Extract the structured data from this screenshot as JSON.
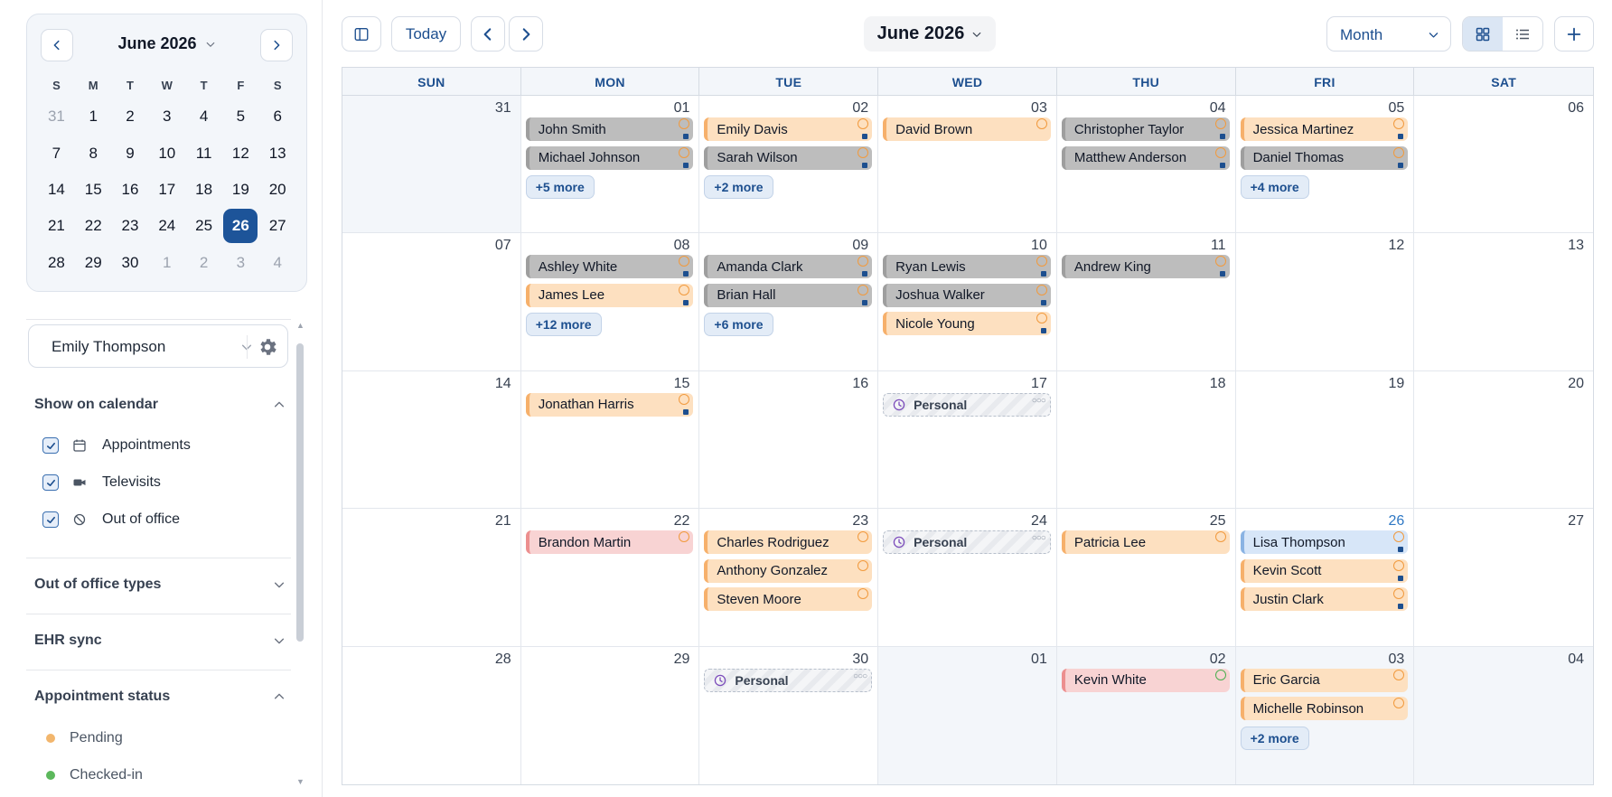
{
  "sidebar": {
    "mini_calendar": {
      "title": "June 2026",
      "weekdays": [
        "S",
        "M",
        "T",
        "W",
        "T",
        "F",
        "S"
      ],
      "weeks": [
        [
          {
            "d": "31",
            "m": true
          },
          {
            "d": "1"
          },
          {
            "d": "2"
          },
          {
            "d": "3"
          },
          {
            "d": "4"
          },
          {
            "d": "5"
          },
          {
            "d": "6"
          }
        ],
        [
          {
            "d": "7"
          },
          {
            "d": "8"
          },
          {
            "d": "9"
          },
          {
            "d": "10"
          },
          {
            "d": "11"
          },
          {
            "d": "12"
          },
          {
            "d": "13"
          }
        ],
        [
          {
            "d": "14"
          },
          {
            "d": "15"
          },
          {
            "d": "16"
          },
          {
            "d": "17"
          },
          {
            "d": "18"
          },
          {
            "d": "19"
          },
          {
            "d": "20"
          }
        ],
        [
          {
            "d": "21"
          },
          {
            "d": "22"
          },
          {
            "d": "23"
          },
          {
            "d": "24"
          },
          {
            "d": "25"
          },
          {
            "d": "26",
            "sel": true
          },
          {
            "d": "27"
          }
        ],
        [
          {
            "d": "28"
          },
          {
            "d": "29"
          },
          {
            "d": "30"
          },
          {
            "d": "1",
            "m": true
          },
          {
            "d": "2",
            "m": true
          },
          {
            "d": "3",
            "m": true
          },
          {
            "d": "4",
            "m": true
          }
        ]
      ]
    },
    "provider": "Emily Thompson",
    "show_on_calendar": {
      "title": "Show on calendar",
      "items": [
        {
          "label": "Appointments",
          "icon": "calendar-icon",
          "checked": true
        },
        {
          "label": "Televisits",
          "icon": "video-icon",
          "checked": true
        },
        {
          "label": "Out of office",
          "icon": "block-icon",
          "checked": true
        }
      ]
    },
    "out_of_office_types": "Out of office types",
    "ehr_sync": "EHR sync",
    "appointment_status": {
      "title": "Appointment status",
      "items": [
        {
          "label": "Pending",
          "color": "#f2b66d"
        },
        {
          "label": "Checked-in",
          "color": "#5cb85c"
        }
      ]
    }
  },
  "toolbar": {
    "today": "Today",
    "month_title": "June 2026",
    "view": "Month",
    "colors": {
      "accent": "#1d4f8f",
      "selected": "#1d5499"
    }
  },
  "calendar": {
    "weekdays": [
      "SUN",
      "MON",
      "TUE",
      "WED",
      "THU",
      "FRI",
      "SAT"
    ],
    "weeks": [
      [
        {
          "day": "31",
          "out": true,
          "items": []
        },
        {
          "day": "01",
          "items": [
            {
              "t": "event",
              "name": "John Smith",
              "c": "gray"
            },
            {
              "t": "event",
              "name": "Michael Johnson",
              "c": "gray"
            },
            {
              "t": "more",
              "label": "+5 more"
            }
          ]
        },
        {
          "day": "02",
          "items": [
            {
              "t": "event",
              "name": "Emily Davis",
              "c": "orange"
            },
            {
              "t": "event",
              "name": "Sarah Wilson",
              "c": "gray"
            },
            {
              "t": "more",
              "label": "+2 more"
            }
          ]
        },
        {
          "day": "03",
          "items": [
            {
              "t": "event",
              "name": "David Brown",
              "c": "orange",
              "icon": "o",
              "noSq": true
            }
          ]
        },
        {
          "day": "04",
          "items": [
            {
              "t": "event",
              "name": "Christopher Taylor",
              "c": "gray"
            },
            {
              "t": "event",
              "name": "Matthew Anderson",
              "c": "gray"
            }
          ]
        },
        {
          "day": "05",
          "items": [
            {
              "t": "event",
              "name": "Jessica Martinez",
              "c": "orange"
            },
            {
              "t": "event",
              "name": "Daniel Thomas",
              "c": "gray"
            },
            {
              "t": "more",
              "label": "+4 more"
            }
          ]
        },
        {
          "day": "06",
          "items": []
        }
      ],
      [
        {
          "day": "07",
          "items": []
        },
        {
          "day": "08",
          "items": [
            {
              "t": "event",
              "name": "Ashley White",
              "c": "gray"
            },
            {
              "t": "event",
              "name": "James Lee",
              "c": "orange"
            },
            {
              "t": "more",
              "label": "+12 more"
            }
          ]
        },
        {
          "day": "09",
          "items": [
            {
              "t": "event",
              "name": "Amanda Clark",
              "c": "gray"
            },
            {
              "t": "event",
              "name": "Brian Hall",
              "c": "gray"
            },
            {
              "t": "more",
              "label": "+6 more"
            }
          ]
        },
        {
          "day": "10",
          "items": [
            {
              "t": "event",
              "name": "Ryan Lewis",
              "c": "gray"
            },
            {
              "t": "event",
              "name": "Joshua Walker",
              "c": "gray"
            },
            {
              "t": "event",
              "name": "Nicole Young",
              "c": "orange"
            }
          ]
        },
        {
          "day": "11",
          "items": [
            {
              "t": "event",
              "name": "Andrew King",
              "c": "gray"
            }
          ]
        },
        {
          "day": "12",
          "items": []
        },
        {
          "day": "13",
          "items": []
        }
      ],
      [
        {
          "day": "14",
          "items": []
        },
        {
          "day": "15",
          "items": [
            {
              "t": "event",
              "name": "Jonathan Harris",
              "c": "orange"
            }
          ]
        },
        {
          "day": "16",
          "items": []
        },
        {
          "day": "17",
          "items": [
            {
              "t": "personal",
              "label": "Personal"
            }
          ]
        },
        {
          "day": "18",
          "items": []
        },
        {
          "day": "19",
          "items": []
        },
        {
          "day": "20",
          "items": []
        }
      ],
      [
        {
          "day": "21",
          "items": []
        },
        {
          "day": "22",
          "items": [
            {
              "t": "event",
              "name": "Brandon Martin",
              "c": "pink",
              "noSq": true
            }
          ]
        },
        {
          "day": "23",
          "items": [
            {
              "t": "event",
              "name": "Charles Rodriguez",
              "c": "orange",
              "noSq": true
            },
            {
              "t": "event",
              "name": "Anthony Gonzalez",
              "c": "orange",
              "noSq": true
            },
            {
              "t": "event",
              "name": "Steven Moore",
              "c": "orange",
              "noSq": true
            }
          ]
        },
        {
          "day": "24",
          "items": [
            {
              "t": "personal",
              "label": "Personal"
            }
          ]
        },
        {
          "day": "25",
          "items": [
            {
              "t": "event",
              "name": "Patricia Lee",
              "c": "orange",
              "noSq": true
            }
          ]
        },
        {
          "day": "26",
          "today": true,
          "items": [
            {
              "t": "event",
              "name": "Lisa Thompson",
              "c": "blue"
            },
            {
              "t": "event",
              "name": "Kevin Scott",
              "c": "orange"
            },
            {
              "t": "event",
              "name": "Justin Clark",
              "c": "orange"
            }
          ]
        },
        {
          "day": "27",
          "items": []
        }
      ],
      [
        {
          "day": "28",
          "items": []
        },
        {
          "day": "29",
          "items": []
        },
        {
          "day": "30",
          "items": [
            {
              "t": "personal",
              "label": "Personal"
            }
          ]
        },
        {
          "day": "01",
          "out": true,
          "items": []
        },
        {
          "day": "02",
          "out": true,
          "items": [
            {
              "t": "event",
              "name": "Kevin White",
              "c": "pink",
              "icon": "g",
              "noSq": true
            }
          ]
        },
        {
          "day": "03",
          "out": true,
          "items": [
            {
              "t": "event",
              "name": "Eric Garcia",
              "c": "orange",
              "noSq": true
            },
            {
              "t": "event",
              "name": "Michelle Robinson",
              "c": "orange",
              "noSq": true
            },
            {
              "t": "more",
              "label": "+2 more"
            }
          ]
        },
        {
          "day": "04",
          "out": true,
          "items": []
        }
      ]
    ]
  }
}
